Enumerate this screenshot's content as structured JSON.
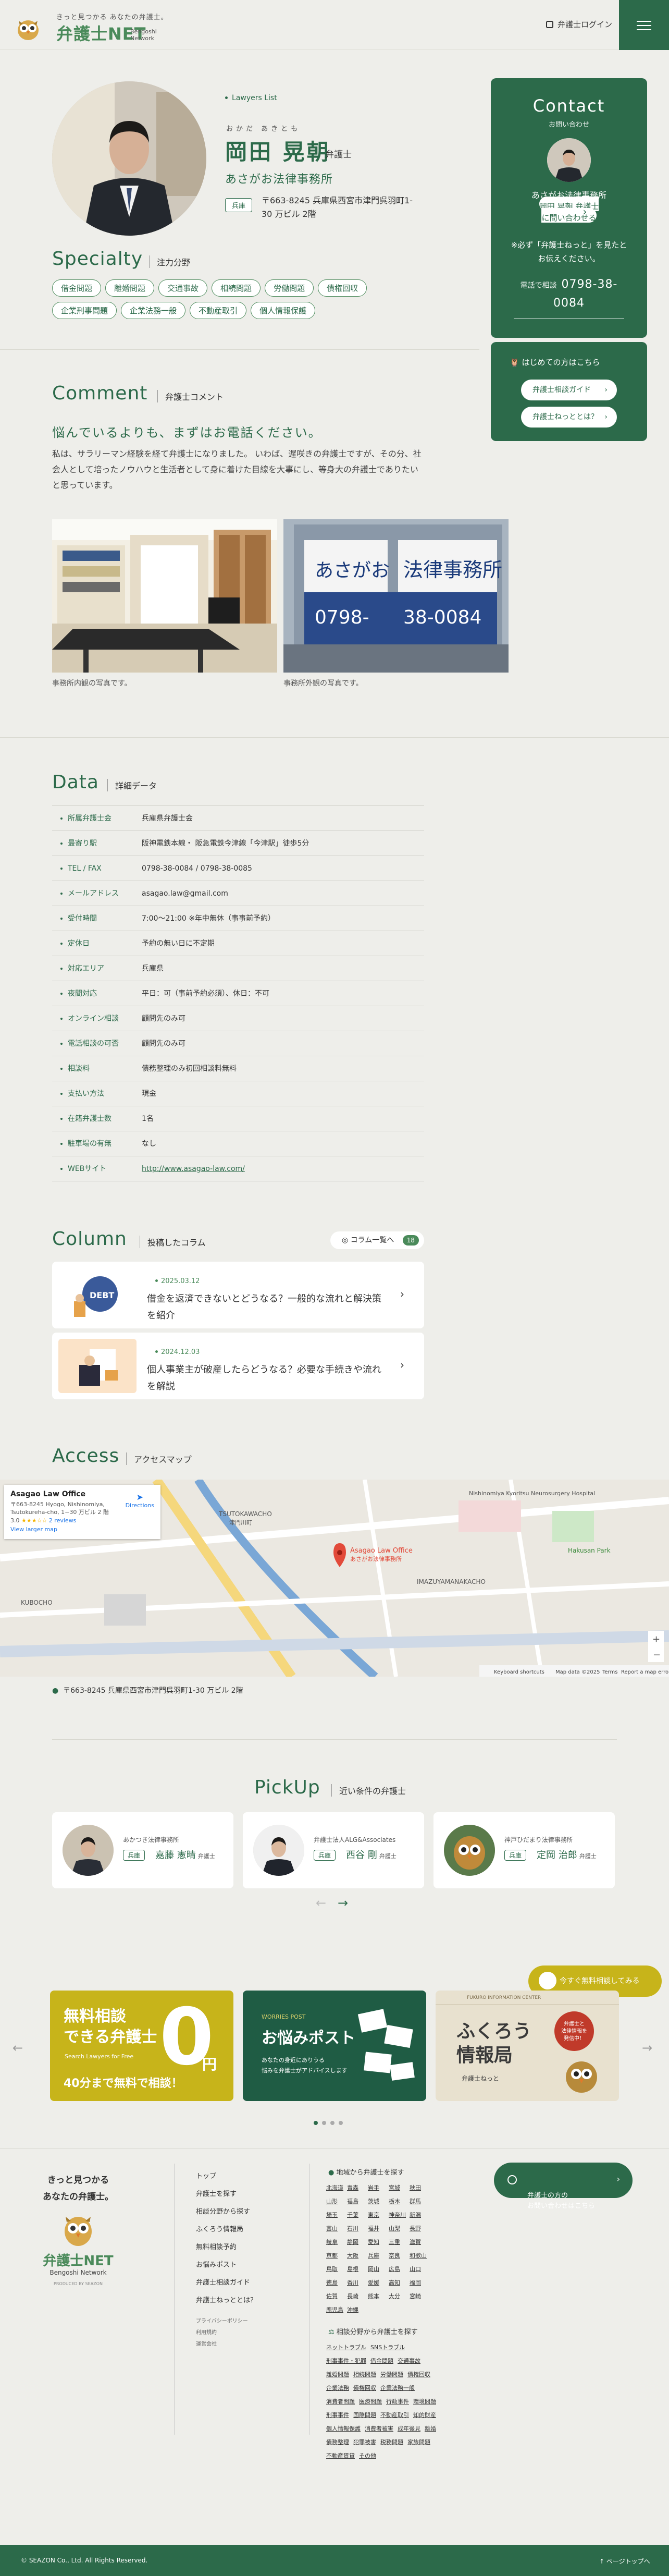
{
  "header": {
    "tagline": "きっと見つかる あなたの弁護士。",
    "logo_name": "弁護士NET",
    "logo_sub": "Bengoshi Network",
    "login": "弁護士ログイン"
  },
  "profile": {
    "breadcrumb": "Lawyers List",
    "kana": "おかだ あきとも",
    "name": "岡田 晃朝",
    "title": "弁護士",
    "firm": "あさがお法律事務所",
    "pref": "兵庫",
    "address": "〒663-8245 兵庫県西宮市津門呉羽町1-30 万ビル 2階"
  },
  "specialty": {
    "heading": "Specialty",
    "sub": "注力分野",
    "tags": [
      "借金問題",
      "離婚問題",
      "交通事故",
      "相続問題",
      "労働問題",
      "債権回収",
      "企業刑事問題",
      "企業法務一般",
      "不動産取引",
      "個人情報保護"
    ]
  },
  "contact": {
    "title": "Contact",
    "sub": "お問い合わせ",
    "firm": "あさがお法律事務所",
    "button": "岡田 晃朝 弁護士\nに問い合わせる",
    "note": "※必ず「弁護士ねっと」を見たと\nお伝えください。",
    "tel_label": "電話で相談",
    "tel": "0798-38-0084"
  },
  "guide": {
    "title": "はじめての方はこちら",
    "btn1": "弁護士相談ガイド",
    "btn2": "弁護士ねっととは？"
  },
  "comment": {
    "heading": "Comment",
    "sub": "弁護士コメント",
    "lead": "悩んでいるよりも、まずはお電話ください。",
    "body": "私は、サラリーマン経験を経て弁護士になりました。 いわば、遅咲きの弁護士ですが、その分、社会人として培ったノウハウと生活者として身に着けた目線を大事にし、等身大の弁護士でありたいと思っています。",
    "cap1": "事務所内観の写真です。",
    "cap2": "事務所外観の写真です。",
    "sign1": "あさがお",
    "sign2": "法律事務所",
    "sign3": "0798-",
    "sign4": "38-0084"
  },
  "data": {
    "heading": "Data",
    "sub": "詳細データ",
    "rows": [
      {
        "k": "所属弁護士会",
        "v": "兵庫県弁護士会"
      },
      {
        "k": "最寄り駅",
        "v": "阪神電鉄本線・ 阪急電鉄今津線「今津駅」徒歩5分"
      },
      {
        "k": "TEL / FAX",
        "v": "0798-38-0084 / 0798-38-0085"
      },
      {
        "k": "メールアドレス",
        "v": "asagao.law@gmail.com"
      },
      {
        "k": "受付時間",
        "v": "7:00〜21:00 ※年中無休（事事前予約）"
      },
      {
        "k": "定休日",
        "v": "予約の無い日に不定期"
      },
      {
        "k": "対応エリア",
        "v": "兵庫県"
      },
      {
        "k": "夜間対応",
        "v": "平日：可（事前予約必須）、休日：不可"
      },
      {
        "k": "オンライン相談",
        "v": "顧問先のみ可"
      },
      {
        "k": "電話相談の可否",
        "v": "顧問先のみ可"
      },
      {
        "k": "相談料",
        "v": "債務整理のみ初回相談料無料"
      },
      {
        "k": "支払い方法",
        "v": "現金"
      },
      {
        "k": "在籍弁護士数",
        "v": "1名"
      },
      {
        "k": "駐車場の有無",
        "v": "なし"
      },
      {
        "k": "WEBサイト",
        "v": "http://www.asagao-law.com/"
      }
    ]
  },
  "column": {
    "heading": "Column",
    "sub": "投稿したコラム",
    "list_btn": "コラム一覧へ",
    "count": "18",
    "items": [
      {
        "date": "2025.03.12",
        "title": "借金を返済できないとどうなる？一般的な流れと解決策を紹介"
      },
      {
        "date": "2024.12.03",
        "title": "個人事業主が破産したらどうなる？必要な手続きや流れを解説"
      }
    ]
  },
  "access": {
    "heading": "Access",
    "sub": "アクセスマップ",
    "map_title": "Asagao Law Office",
    "map_addr": "〒663-8245 Hyogo, Nishinomiya,\nTsutokureha-cho, 1−30 万ビル 2 階",
    "map_rating": "3.0",
    "map_reviews": "2 reviews",
    "map_larger": "View larger map",
    "map_dir": "Directions",
    "address": "〒663-8245 兵庫県西宮市津門呉羽町1-30 万ビル 2階",
    "map_labels": [
      "Asagao Law Office",
      "あさがお法律事務所",
      "TSUTOKAWACHO",
      "津門川町",
      "IMAZUYAMANAKACHO",
      "KUBOCHO",
      "Nishinomiya Kyoritsu Neurosurgery Hospital",
      "Hakusan Park",
      "Keyboard shortcuts",
      "Map data ©2025",
      "Terms",
      "Report a map error"
    ]
  },
  "pickup": {
    "heading": "PickUp",
    "sub": "近い条件の弁護士",
    "items": [
      {
        "firm": "あかつき法律事務所",
        "pref": "兵庫",
        "name": "嘉藤 憲晴",
        "title": "弁護士"
      },
      {
        "firm": "弁護士法人ALG&Associates",
        "pref": "兵庫",
        "name": "西谷 剛",
        "title": "弁護士"
      },
      {
        "firm": "神戸ひだまり法律事務所",
        "pref": "兵庫",
        "name": "定岡 治郎",
        "title": "弁護士"
      }
    ]
  },
  "float_btn": "今すぐ無料相談してみる",
  "banners": {
    "b1_title": "無料相談\nできる弁護士",
    "b1_sub": "Search Lawyers for Free",
    "b1_foot": "40分まで無料で相談！",
    "b1_zero": "0",
    "b1_unit": "円",
    "b2_sub": "WORRIES POST",
    "b2_title": "お悩みポスト",
    "b2_body": "あなたの身近にありうる\n悩みを弁護士がアドバイスします",
    "b3_head": "FUKURO INFORMATION CENTER",
    "b3_title": "ふくろう\n情報局",
    "b3_foot": "弁護士ねっと",
    "b3_bubble": "弁護士と\n法律情報を\n発信中！"
  },
  "footer": {
    "catch": "きっと見つかる\nあなたの弁護士。",
    "logo": "弁護士NET",
    "logo_sub": "Bengoshi Network",
    "produced": "PRODUCED BY SEAZON",
    "links": [
      "トップ",
      "弁護士を探す",
      "相談分野から探す",
      "ふくろう情報局",
      "無料相談予約",
      "お悩みポスト",
      "弁護士相談ガイド",
      "弁護士ねっととは？"
    ],
    "small_links": [
      "プライバシーポリシー",
      "利用規約",
      "運営会社"
    ],
    "area_title": "地域から弁護士を探す",
    "prefs": [
      "北海道",
      "青森",
      "岩手",
      "宮城",
      "秋田",
      "山形",
      "福島",
      "茨城",
      "栃木",
      "群馬",
      "埼玉",
      "千葉",
      "東京",
      "神奈川",
      "新潟",
      "富山",
      "石川",
      "福井",
      "山梨",
      "長野",
      "岐阜",
      "静岡",
      "愛知",
      "三重",
      "滋賀",
      "京都",
      "大阪",
      "兵庫",
      "奈良",
      "和歌山",
      "鳥取",
      "島根",
      "岡山",
      "広島",
      "山口",
      "徳島",
      "香川",
      "愛媛",
      "高知",
      "福岡",
      "佐賀",
      "長崎",
      "熊本",
      "大分",
      "宮崎",
      "鹿児島",
      "沖縄"
    ],
    "field_title": "相談分野から弁護士を探す",
    "fields": [
      "ネットトラブル",
      "SNSトラブル",
      "刑事事件・犯罪",
      "借金問題",
      "交通事故",
      "離婚問題",
      "相続問題",
      "労働問題",
      "債権回収",
      "企業法務",
      "債権回収",
      "企業法務一般",
      "消費者問題",
      "医療問題",
      "行政事件",
      "環境問題",
      "刑事事件",
      "国際問題",
      "不動産取引",
      "知的財産",
      "個人情報保護",
      "消費者被害",
      "成年後見",
      "離婚",
      "債務整理",
      "犯罪被害",
      "税務問題",
      "家族問題",
      "不動産賃貸",
      "その他"
    ],
    "contact_btn": "弁護士の方の\nお問い合わせはこちら",
    "copyright": "© SEAZON Co., Ltd. All Rights Reserved.",
    "pagetop": "ページトップへ"
  },
  "colors": {
    "primary": "#2c6a4a",
    "accent": "#4a8a5a",
    "yellow": "#c7b41a",
    "bg": "#eeeeea"
  }
}
